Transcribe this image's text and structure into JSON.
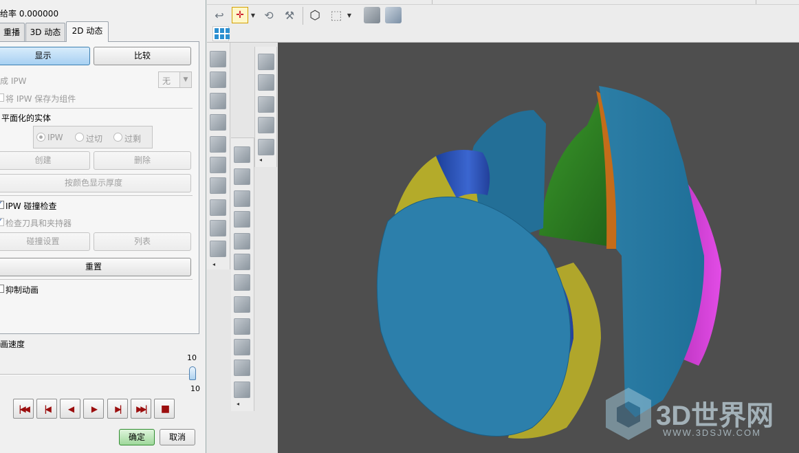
{
  "panel": {
    "rate_label": "给率 0.000000",
    "tabs": [
      {
        "label": "重播"
      },
      {
        "label": "3D 动态"
      },
      {
        "label": "2D 动态"
      }
    ],
    "show_button": "显示",
    "compare_button": "比较",
    "ipw_label": "成 IPW",
    "ipw_select_value": "无",
    "save_ipw_label": "将 IPW 保存为组件",
    "faceted_section": "平面化的实体",
    "radio_options": [
      "IPW",
      "过切",
      "过剩"
    ],
    "create_button": "创建",
    "delete_button": "删除",
    "thickness_button": "按颜色显示厚度",
    "ipw_collision_label": "IPW 碰撞检查",
    "check_tool_holder_label": "检查刀具和夹持器",
    "collision_settings_button": "碰撞设置",
    "list_button": "列表",
    "reset_button": "重置",
    "suppress_animation_label": "抑制动画",
    "speed_label": "画速度",
    "speed_value": "10",
    "speed_fraction": 1.0,
    "speed_max_label": "10",
    "playback_buttons": [
      "|◀◀",
      "|◀",
      "◀",
      "▶",
      "▶|",
      "▶▶|",
      "■"
    ],
    "ok_button": "确定",
    "cancel_button": "取消"
  },
  "watermark": {
    "brand": "3D世界网",
    "url": "WWW.3DSJW.COM"
  }
}
